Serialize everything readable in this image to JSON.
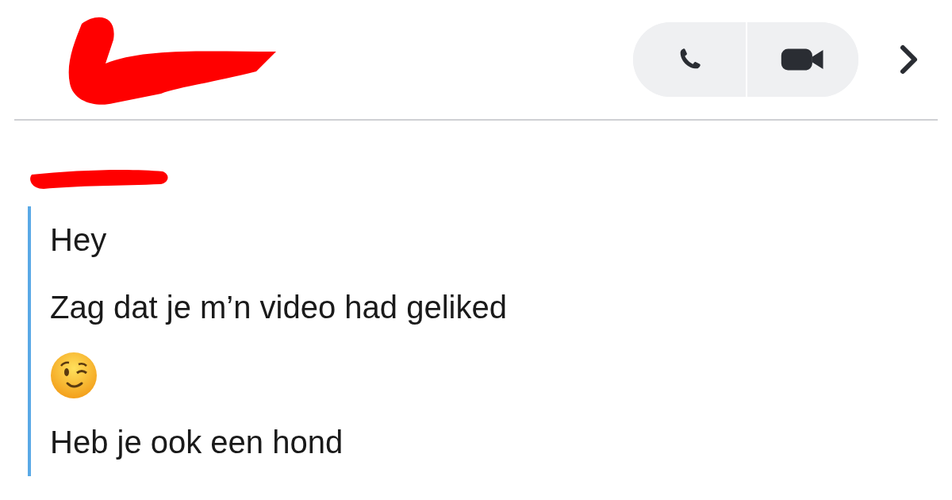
{
  "header": {
    "actions": [
      {
        "kind": "call"
      },
      {
        "kind": "video"
      }
    ],
    "more": {
      "kind": "chevron"
    }
  },
  "messages": [
    {
      "kind": "text",
      "text": "Hey"
    },
    {
      "kind": "text",
      "text": "Zag dat je m’n video had geliked"
    },
    {
      "kind": "emoji"
    },
    {
      "kind": "text",
      "text": "Heb je ook een hond"
    }
  ]
}
